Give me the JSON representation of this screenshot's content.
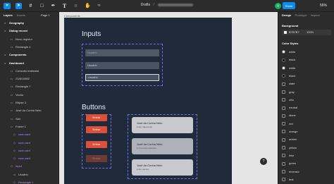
{
  "toolbar": {
    "title": "Drafts",
    "title_sep": "/",
    "share_label": "Share",
    "avatar_initial": "V",
    "zoom": "56%"
  },
  "left_panel": {
    "tabs": [
      "Layers",
      "Assets"
    ],
    "page": "Page 1",
    "layers": [
      {
        "label": "Geography",
        "kind": "section"
      },
      {
        "label": "Dialog record",
        "kind": "section"
      },
      {
        "label": "Novo registro",
        "kind": "layer"
      },
      {
        "label": "Rectangle 4",
        "kind": "layer"
      },
      {
        "label": "Components",
        "kind": "section"
      },
      {
        "label": "Dashboard",
        "kind": "section"
      },
      {
        "label": "Consulta realizada",
        "kind": "layer"
      },
      {
        "label": "21/8/10802",
        "kind": "layer"
      },
      {
        "label": "Rectangle 7",
        "kind": "layer"
      },
      {
        "label": "Vector",
        "kind": "layer"
      },
      {
        "label": "Ellipse 3",
        "kind": "layer"
      },
      {
        "label": "José da Cunha Neto",
        "kind": "layer"
      },
      {
        "label": "Sair",
        "kind": "layer"
      },
      {
        "label": "Frame 1",
        "kind": "layer"
      },
      {
        "label": "user-card",
        "kind": "component"
      },
      {
        "label": "user-card",
        "kind": "component"
      },
      {
        "label": "user-card",
        "kind": "component"
      },
      {
        "label": "user-card",
        "kind": "component"
      },
      {
        "label": "Input",
        "kind": "component"
      },
      {
        "label": "Usuário",
        "kind": "layer"
      },
      {
        "label": "Rectangle 1",
        "kind": "component"
      }
    ]
  },
  "canvas": {
    "frame_label": "Components",
    "inputs_title": "Inputs",
    "inputs": [
      "Usuário",
      "Usuário",
      "Usuário"
    ],
    "buttons_title": "Buttons",
    "buttons": [
      "Entrar",
      "Entrar",
      "Entrar",
      "Entrar"
    ],
    "cards": [
      {
        "name": "José da Cunha Neto",
        "status": "● Em trajamento"
      },
      {
        "name": "José da Cunha Neto",
        "status": "● Consulta realizada"
      },
      {
        "name": "José da Cunha Neto",
        "status": "● Em espera"
      }
    ]
  },
  "right_panel": {
    "tabs": [
      "Design",
      "Prototype",
      "Inspect"
    ],
    "background_heading": "Background",
    "background_hex": "B7B7B7",
    "background_opacity": "100%",
    "color_styles_heading": "Color Styles",
    "styles": [
      {
        "label": "white",
        "color": "#ffffff",
        "type": "dot"
      },
      {
        "label": "black",
        "color": "#000000",
        "type": "dot"
      },
      {
        "label": "white",
        "color": "#ffffff",
        "type": "dot"
      },
      {
        "label": "black",
        "color": "#000000",
        "type": "dot"
      },
      {
        "label": "slate",
        "type": "grid"
      },
      {
        "label": "gray",
        "type": "grid"
      },
      {
        "label": "zinc",
        "type": "grid"
      },
      {
        "label": "neutral",
        "type": "grid"
      },
      {
        "label": "stone",
        "type": "grid"
      },
      {
        "label": "red",
        "type": "grid"
      },
      {
        "label": "orange",
        "type": "grid"
      },
      {
        "label": "amber",
        "type": "grid"
      },
      {
        "label": "yellow",
        "type": "grid"
      },
      {
        "label": "lime",
        "type": "grid"
      },
      {
        "label": "green",
        "type": "grid"
      },
      {
        "label": "emerald",
        "type": "grid"
      },
      {
        "label": "teal",
        "type": "grid"
      }
    ]
  },
  "colors": {
    "accent": "#0c8ce9",
    "frame_bg": "#1f2a3b",
    "button": "#d9503c",
    "component": "#b48cf2"
  },
  "icons": [
    "figma-menu-icon",
    "move-icon",
    "frame-icon",
    "shape-icon",
    "pen-icon",
    "text-icon",
    "comment-icon",
    "hand-icon",
    "code-icon",
    "play-icon",
    "help-icon"
  ]
}
